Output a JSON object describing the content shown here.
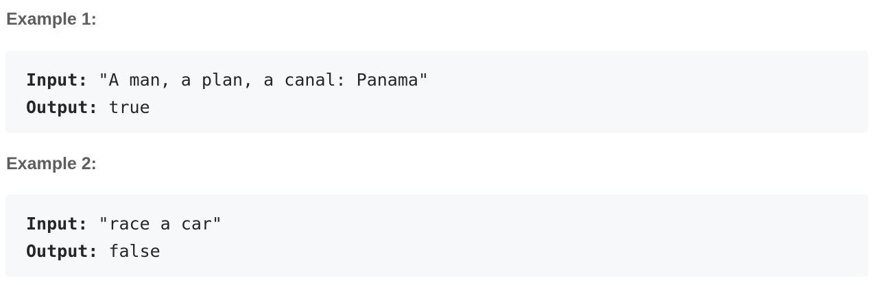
{
  "examples": [
    {
      "heading": "Example 1:",
      "input_label": "Input:",
      "input_value": " \"A man, a plan, a canal: Panama\"",
      "output_label": "Output:",
      "output_value": " true"
    },
    {
      "heading": "Example 2:",
      "input_label": "Input:",
      "input_value": " \"race a car\"",
      "output_label": "Output:",
      "output_value": " false"
    }
  ]
}
